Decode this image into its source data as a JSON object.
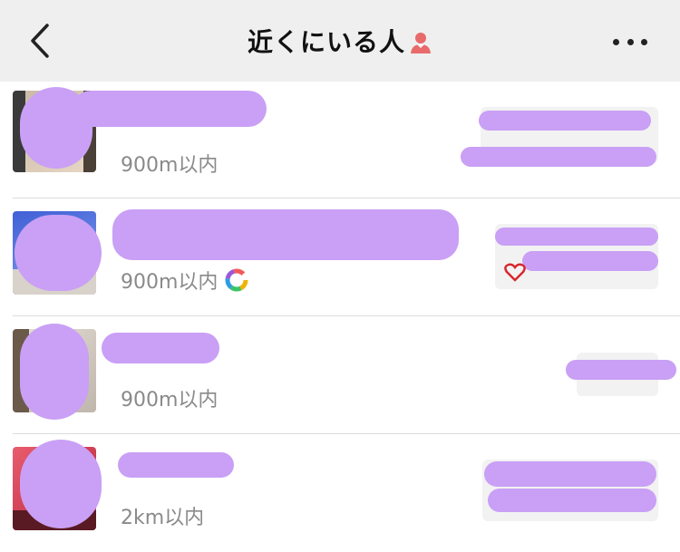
{
  "header": {
    "title": "近くにいる人",
    "icons": {
      "back": "chevron-left-icon",
      "title": "person-icon",
      "more": "more-dots-icon"
    }
  },
  "rows": [
    {
      "distance": "900m以内",
      "has_status_icon": false
    },
    {
      "distance": "900m以内",
      "has_status_icon": true,
      "status_icon": "colorful-ring-icon"
    },
    {
      "distance": "900m以内",
      "has_status_icon": false
    },
    {
      "distance": "2km以内",
      "has_status_icon": false
    }
  ],
  "colors": {
    "header_bg": "#efefef",
    "redaction": "#c9a0f5",
    "secondary_text": "#8a8a8a",
    "title_icon": "#e86a6a"
  }
}
